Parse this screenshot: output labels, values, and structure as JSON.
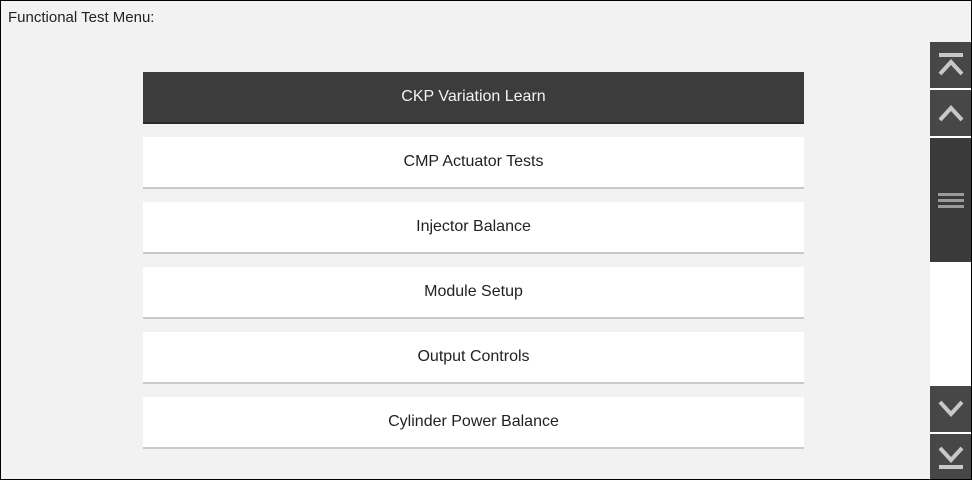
{
  "page": {
    "title": "Functional Test Menu:"
  },
  "menu": {
    "selected_index": 0,
    "items": [
      {
        "label": "CKP Variation Learn"
      },
      {
        "label": "CMP Actuator Tests"
      },
      {
        "label": "Injector Balance"
      },
      {
        "label": "Module Setup"
      },
      {
        "label": "Output Controls"
      },
      {
        "label": "Cylinder Power Balance"
      }
    ]
  },
  "scrollbar": {
    "buttons": {
      "top": "scroll-to-top-icon",
      "up": "chevron-up-icon",
      "thumb": "scroll-grip-icon",
      "down": "chevron-down-icon",
      "bottom": "scroll-to-bottom-icon"
    }
  },
  "colors": {
    "selected_item_bg": "#3c3c3c",
    "selected_item_text": "#f2f2f2",
    "item_bg": "#ffffff",
    "panel_bg": "#f2f2f2",
    "scrollbar_button": "#474747",
    "scrollbar_thumb": "#3a3a3a"
  }
}
